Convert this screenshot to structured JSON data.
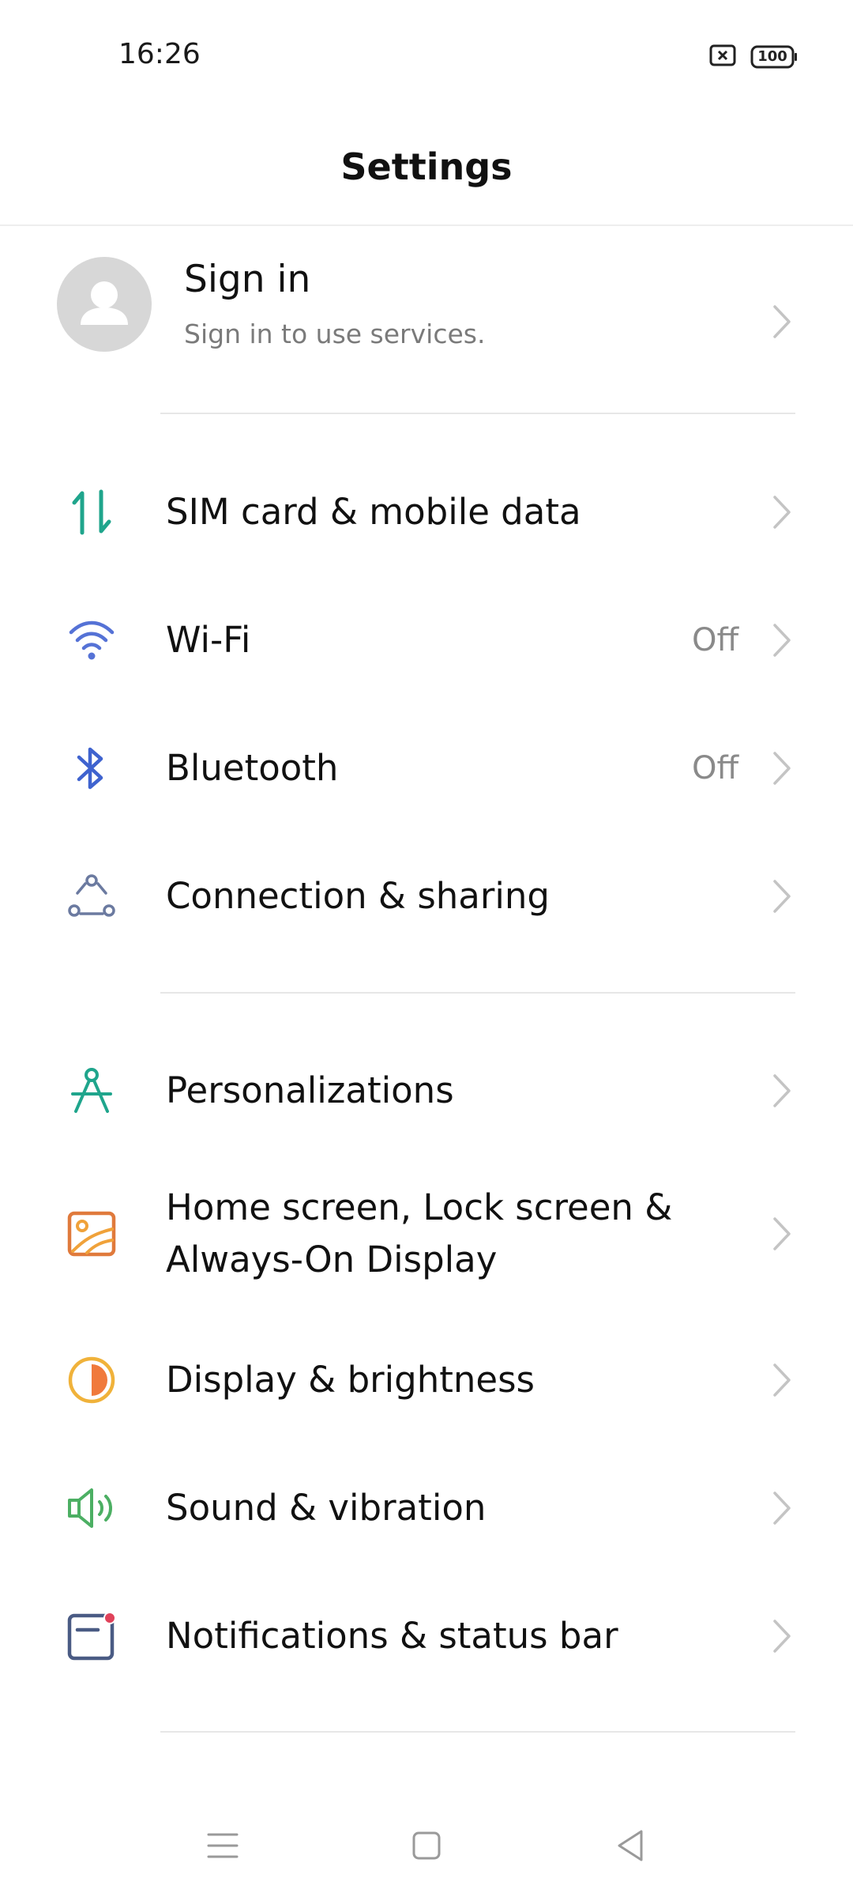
{
  "status_bar": {
    "time": "16:26",
    "battery_level": "100",
    "icons": [
      "no-sim-icon",
      "battery-icon"
    ]
  },
  "header": {
    "title": "Settings"
  },
  "account": {
    "title": "Sign in",
    "subtitle": "Sign in to use services.",
    "icon": "avatar-placeholder-icon"
  },
  "groups": [
    {
      "items": [
        {
          "label": "SIM card & mobile data",
          "value": "",
          "icon": "mobile-data-icon",
          "color": "#1fa58c"
        },
        {
          "label": "Wi-Fi",
          "value": "Off",
          "icon": "wifi-icon",
          "color": "#5572d6"
        },
        {
          "label": "Bluetooth",
          "value": "Off",
          "icon": "bluetooth-icon",
          "color": "#3f63cf"
        },
        {
          "label": "Connection & sharing",
          "value": "",
          "icon": "connection-sharing-icon",
          "color": "#6b7aa0"
        }
      ]
    },
    {
      "items": [
        {
          "label": "Personalizations",
          "value": "",
          "icon": "personalization-icon",
          "color": "#1fa58c"
        },
        {
          "label": "Home screen, Lock screen &",
          "label_line2": "Always-On Display",
          "value": "",
          "icon": "wallpaper-icon",
          "color": "#e07a3c"
        },
        {
          "label": "Display & brightness",
          "value": "",
          "icon": "brightness-icon",
          "color": "#f0b23a"
        },
        {
          "label": "Sound & vibration",
          "value": "",
          "icon": "speaker-icon",
          "color": "#4caf63"
        },
        {
          "label": "Notifications & status bar",
          "value": "",
          "icon": "notification-icon",
          "color": "#4a5b84"
        }
      ]
    }
  ],
  "nav_bar": {
    "icons": [
      "menu-icon",
      "home-icon",
      "back-icon"
    ]
  },
  "colors": {
    "chevron": "#c4c4c4",
    "secondary_text": "#8a8a8a",
    "divider": "#e7e7e7"
  }
}
